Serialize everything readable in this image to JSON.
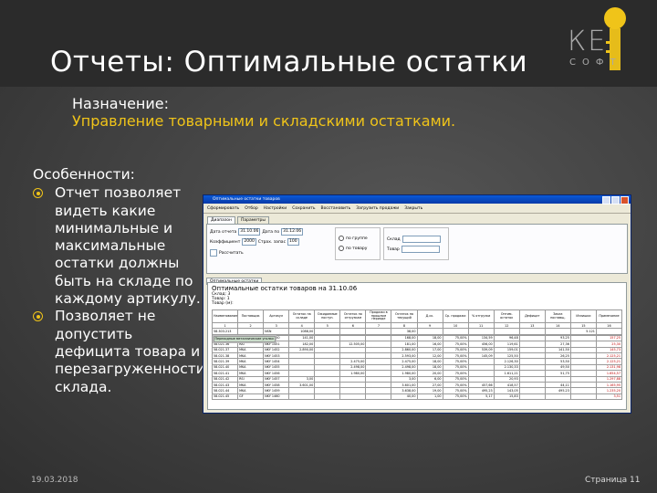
{
  "slide": {
    "title": "Отчеты: Оптимальные остатки",
    "logo": {
      "text": "КЕ",
      "sub": "СОФТ"
    },
    "purpose_label": "Назначение:",
    "purpose_text": "Управление товарными и складскими остатками.",
    "features_heading": "Особенности:",
    "bullets": [
      "Отчет позволяет видеть какие минимальные и максимальные остатки должны быть на складе по каждому артикулу.",
      "Позволяет не допустить дефицита товара и перезагруженности склада."
    ],
    "footer_date": "19.03.2018",
    "footer_page": "Страница 11",
    "colors": {
      "accent": "#f0c419",
      "background": "#3a3a3a"
    }
  },
  "app": {
    "window_title": "Оптимальные остатки товаров",
    "toolbar": [
      "Сформировать",
      "Отбор",
      "Настройки",
      "Сохранить",
      "Восстановить",
      "Загрузить продажи",
      "Закрыть"
    ],
    "param_tabs": [
      "Диапазон",
      "Параметры"
    ],
    "date_from_label": "Дата отчета",
    "date_from": "31.10.06",
    "date_to_label": "Дата по",
    "date_to": "31.12.06",
    "coef_label": "Коэффициент",
    "coef_value": "2000",
    "coef2_label": "Страх. запас",
    "coef2_value": "100",
    "checkbox_label": "Рассчитать",
    "radio_options": [
      "по группе",
      "по товару"
    ],
    "field_labels": [
      "Склад",
      "Товар"
    ],
    "report_tab": "Оптимальные остатки",
    "report_title": "Оптимальные остатки товаров на 31.10.06",
    "report_sub1": "Склад: 3",
    "report_sub2": "Товар: 1",
    "report_sub3": "Товар (м):",
    "table": {
      "headers": [
        "Наименование",
        "Поставщик",
        "Артикул",
        "Остаток на складе",
        "Ожидаемые поступ.",
        "Остаток по отгрузкам",
        "Продажи в прошлом периоде",
        "Остаток на текущий",
        "Д.ск.",
        "Ср. продажи",
        "% отгрузки",
        "Оптим. остаток",
        "Дефицит",
        "Заказ поставщ.",
        "Излишки",
        "Примечание"
      ],
      "numbers": [
        "1",
        "2",
        "3",
        "4",
        "5",
        "6",
        "7",
        "8",
        "9",
        "10",
        "11",
        "12",
        "13",
        "14",
        "15",
        "16"
      ],
      "total_row": [
        "58.303.213",
        "",
        "NSN",
        "1088,00",
        "",
        "",
        "",
        "38,00",
        "",
        "",
        "",
        "",
        "",
        "",
        "5.121",
        ""
      ],
      "group_label": "Переходные металлические уголки",
      "rows": [
        [
          "58.021.35",
          "GF",
          "NKY 1450",
          "141,00",
          "",
          "",
          "",
          "168,00",
          "18,00",
          "75,00%",
          "134,59",
          "96,48",
          "",
          "93,25",
          "",
          "157,25"
        ],
        [
          "58.021.36",
          "RAI",
          "NKY 1451",
          "182,00",
          "",
          "12.505,00",
          "",
          "181,00",
          "16,00",
          "75,00%",
          "456,00",
          "119,61",
          "",
          "27,36",
          "",
          "25,30"
        ],
        [
          "58.021.37",
          "MKA",
          "NKY 1452",
          "2.890,00",
          "",
          "",
          "",
          "2.860,00",
          "17,00",
          "75,00%",
          "539,09",
          "159,01",
          "",
          "141,50",
          "",
          "145,73"
        ],
        [
          "58.021.38",
          "MKA",
          "NKY 1453",
          "",
          "",
          "",
          "",
          "2.593,00",
          "12,00",
          "75,00%",
          "145,09",
          "125,50",
          "",
          "26,25",
          "",
          "2.125,21"
        ],
        [
          "58.021.39",
          "MKA",
          "NKY 1454",
          "",
          "",
          "2.475,00",
          "",
          "2.475,00",
          "18,00",
          "75,00%",
          "",
          "2.126,30",
          "",
          "53,50",
          "",
          "2.125,21"
        ],
        [
          "58.021.40",
          "MKA",
          "NKY 1455",
          "",
          "",
          "2.498,00",
          "",
          "2.498,00",
          "18,00",
          "75,00%",
          "",
          "2.130,33",
          "",
          "49,50",
          "",
          "2.131,98"
        ],
        [
          "58.021.41",
          "MKA",
          "NKY 1456",
          "",
          "",
          "1.980,00",
          "",
          "1.980,00",
          "20,00",
          "75,00%",
          "",
          "1.611,21",
          "",
          "51,75",
          "",
          "1.654,57"
        ],
        [
          "58.021.42",
          "RSI",
          "NKY 1457",
          "3,00",
          "",
          "",
          "",
          "3,00",
          "6,00",
          "75,00%",
          "",
          "20,93",
          "",
          "",
          "",
          "1.297,88"
        ],
        [
          "58.021.43",
          "MKA",
          "NKY 1458",
          "3.601,00",
          "",
          "",
          "",
          "3.601,00",
          "27,00",
          "75,00%",
          "457,66",
          "418,57",
          "",
          "44,11",
          "",
          "1.165,95"
        ],
        [
          "58.021.44",
          "MKA",
          "NKY 1459",
          "",
          "",
          "",
          "",
          "3.638,00",
          "19,00",
          "75,00%",
          "495,23",
          "143,05",
          "",
          "495,23",
          "",
          "1.235,20"
        ],
        [
          "58.021.45",
          "GF",
          "NKY 1460",
          "",
          "",
          "",
          "",
          "40,00",
          "1,00",
          "75,00%",
          "5,17",
          "15,83",
          "",
          "",
          "",
          "3,51"
        ]
      ]
    }
  }
}
